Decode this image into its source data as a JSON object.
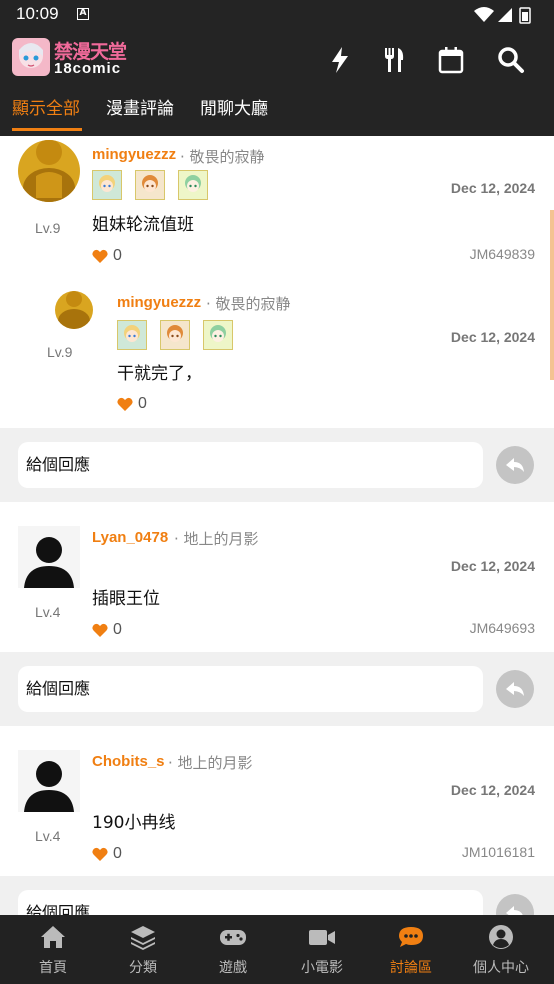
{
  "status_bar": {
    "time": "10:09",
    "notification_icon": "A"
  },
  "header": {
    "logo_text_cn": "禁漫天堂",
    "logo_text_en": "18comic",
    "icons": [
      "bolt-icon",
      "utensils-icon",
      "calendar-icon",
      "search-icon"
    ]
  },
  "tabs": [
    {
      "label": "顯示全部",
      "active": true
    },
    {
      "label": "漫畫評論",
      "active": false
    },
    {
      "label": "閒聊大廳",
      "active": false
    }
  ],
  "comments": [
    {
      "username": "mingyuezzz",
      "title": "· 敬畏的寂静",
      "level": "Lv.9",
      "date": "Dec 12, 2024",
      "text": "姐妹轮流值班",
      "likes": "0",
      "id": "JM649839",
      "replies": [
        {
          "username": "mingyuezzz",
          "title": "· 敬畏的寂静",
          "level": "Lv.9",
          "date": "Dec 12, 2024",
          "text": "干就完了，",
          "likes": "0"
        }
      ]
    },
    {
      "username": "Lyan_0478",
      "title": "· 地上的月影",
      "level": "Lv.4",
      "date": "Dec 12, 2024",
      "text": "插眼王位",
      "likes": "0",
      "id": "JM649693"
    },
    {
      "username": "Chobits_s",
      "title": "· 地上的月影",
      "level": "Lv.4",
      "date": "Dec 12, 2024",
      "text": "190小冉线",
      "likes": "0",
      "id": "JM1016181"
    }
  ],
  "reply_placeholder": "給個回應",
  "bottom_nav": [
    {
      "label": "首頁",
      "icon": "home-icon"
    },
    {
      "label": "分類",
      "icon": "layers-icon"
    },
    {
      "label": "遊戲",
      "icon": "gamepad-icon"
    },
    {
      "label": "小電影",
      "icon": "video-icon"
    },
    {
      "label": "討論區",
      "icon": "chat-icon",
      "active": true
    },
    {
      "label": "個人中心",
      "icon": "user-icon"
    }
  ],
  "colors": {
    "accent": "#f07f12",
    "bar_bg": "#242424",
    "content_bg": "#f0f0f0"
  }
}
